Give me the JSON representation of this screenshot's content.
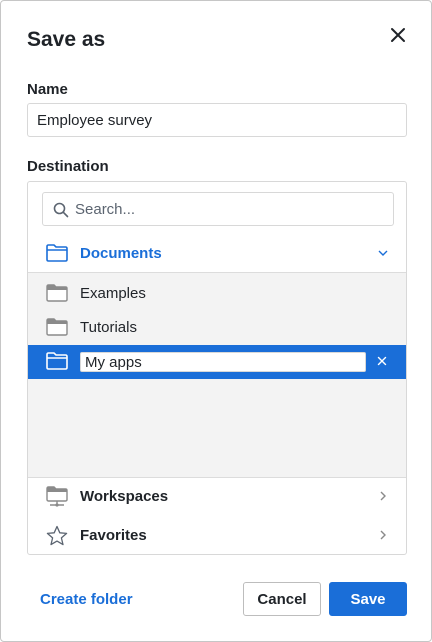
{
  "dialog": {
    "title": "Save as",
    "name_label": "Name",
    "name_value": "Employee survey",
    "destination_label": "Destination"
  },
  "search": {
    "placeholder": "Search...",
    "value": ""
  },
  "tree": {
    "current_folder": "Documents",
    "items": [
      {
        "label": "Examples"
      },
      {
        "label": "Tutorials"
      }
    ],
    "new_folder_value": "My apps"
  },
  "sections": {
    "workspaces": "Workspaces",
    "favorites": "Favorites"
  },
  "footer": {
    "create_folder": "Create folder",
    "cancel": "Cancel",
    "save": "Save"
  },
  "colors": {
    "accent": "#1a6ed8",
    "folder_gray": "#8a8a8a",
    "list_bg": "#f3f3f3"
  },
  "icons": [
    "close-icon",
    "search-icon",
    "folder-icon",
    "chevron-down-icon",
    "chevron-right-icon",
    "workspace-icon",
    "star-icon"
  ]
}
